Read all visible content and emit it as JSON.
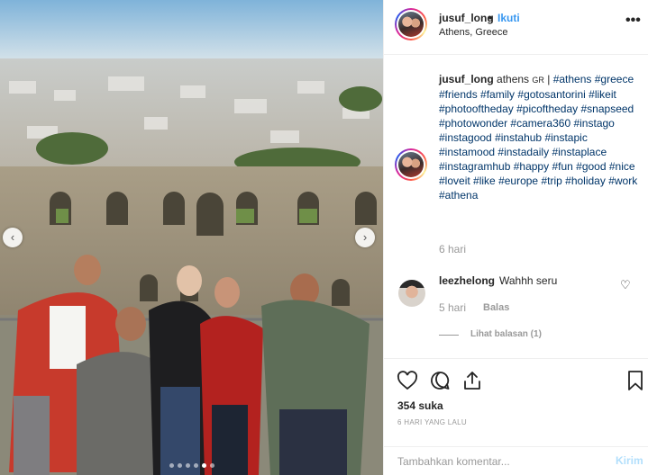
{
  "header": {
    "username": "jusuf_long",
    "separator": "•",
    "follow_label": "Ikuti",
    "location": "Athens, Greece",
    "more_label": "•••"
  },
  "caption": {
    "username": "jusuf_long",
    "text_prefix": "athens",
    "country_code": "GR",
    "divider": "|",
    "hashtags": [
      "#athens",
      "#greece",
      "#friends",
      "#family",
      "#gotosantorini",
      "#likeit",
      "#photooftheday",
      "#picoftheday",
      "#snapseed",
      "#photowonder",
      "#camera360",
      "#instago",
      "#instagood",
      "#instahub",
      "#instapic",
      "#instamood",
      "#instadaily",
      "#instaplace",
      "#instagramhub",
      "#happy",
      "#fun",
      "#good",
      "#nice",
      "#loveit",
      "#like",
      "#europe",
      "#trip",
      "#holiday",
      "#work",
      "#athena"
    ],
    "time": "6 hari"
  },
  "comment": {
    "username": "leezhelong",
    "text": "Wahhh seru",
    "time": "5 hari",
    "reply_label": "Balas",
    "view_replies": "Lihat balasan (1)"
  },
  "actions": {
    "icons": [
      "heart-icon",
      "comment-icon",
      "share-icon",
      "bookmark-icon"
    ],
    "likes": "354 suka",
    "time_ago": "6 HARI YANG LALU"
  },
  "add_comment": {
    "placeholder": "Tambahkan komentar...",
    "post_label": "Kirim"
  },
  "carousel": {
    "slide_count": 6,
    "active_index": 4,
    "prev_icon": "chevron-left-icon",
    "next_icon": "chevron-right-icon"
  },
  "colors": {
    "accent": "#3897f0",
    "hashtag": "#003569",
    "muted": "#999999",
    "post_disabled": "#b2dffc"
  }
}
